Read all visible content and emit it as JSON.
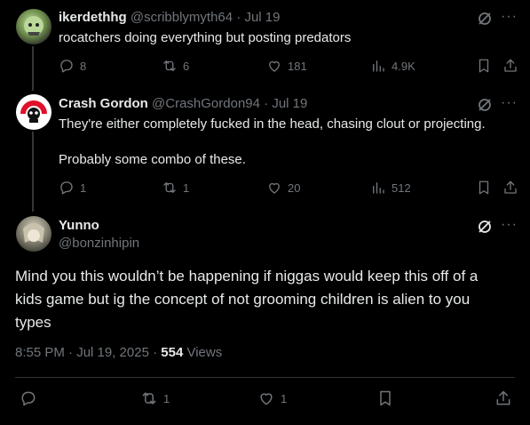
{
  "tweets": [
    {
      "name": "ikerdethhg",
      "handle": "@scribblymyth64",
      "date": "· Jul 19",
      "text": "rocatchers doing everything but posting predators",
      "replies": "8",
      "retweets": "6",
      "likes": "181",
      "views": "4.9K"
    },
    {
      "name": "Crash Gordon",
      "handle": "@CrashGordon94",
      "date": "· Jul 19",
      "text1": "They're either completely fucked in the head, chasing clout or projecting.",
      "text2": "Probably some combo of these.",
      "replies": "1",
      "retweets": "1",
      "likes": "20",
      "views": "512"
    }
  ],
  "main": {
    "name": "Yunno",
    "handle": "@bonzinhipin",
    "text": "Mind you this wouldn’t be happening if niggas would keep this off of a kids game but ig the concept of not grooming children is alien to you types",
    "timestamp": "8:55 PM · Jul 19, 2025 · ",
    "views_count": "554",
    "views_label": " Views",
    "retweets": "1",
    "likes": "1"
  },
  "colors": {
    "background": "#000000",
    "text": "#e7e9ea",
    "muted": "#71767b",
    "divider": "#2f3336"
  },
  "icons": [
    "grok-icon",
    "more-icon",
    "reply-icon",
    "retweet-icon",
    "like-icon",
    "views-icon",
    "bookmark-icon",
    "share-icon"
  ]
}
